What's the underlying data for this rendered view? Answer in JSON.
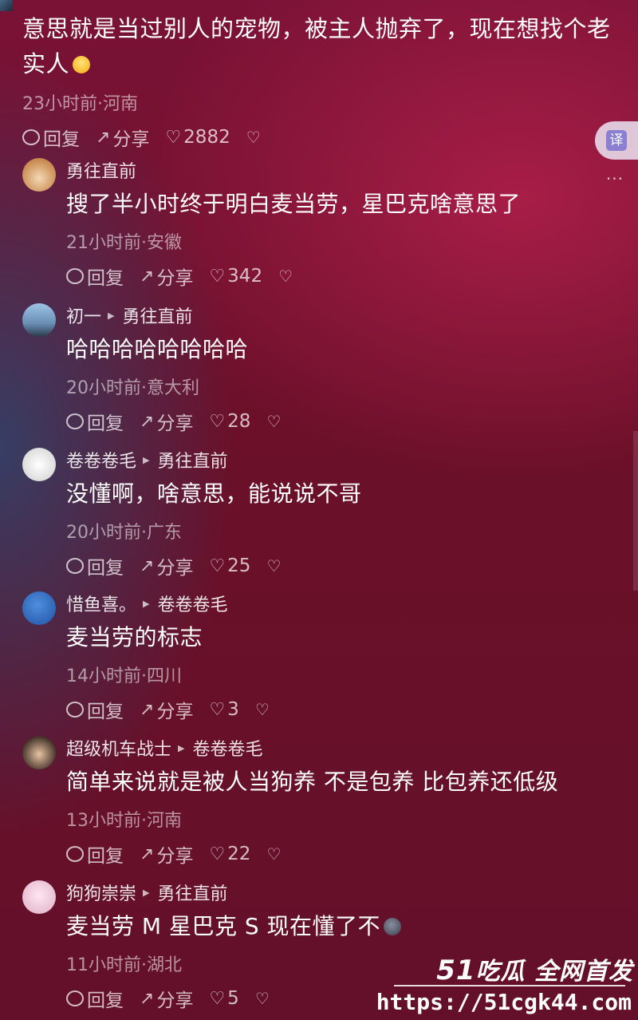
{
  "top_comment": {
    "text": "意思就是当过别人的宠物，被主人抛弃了，现在想找个老实人",
    "meta": "23小时前·河南",
    "reply": "回复",
    "share": "分享",
    "likes": "2882"
  },
  "translate_button": {
    "label": "译"
  },
  "more_button": {
    "label": "···"
  },
  "comments": [
    {
      "user": "勇往直前",
      "reply_to": "",
      "text": "搜了半小时终于明白麦当劳，星巴克啥意思了",
      "meta": "21小时前·安徽",
      "reply": "回复",
      "share": "分享",
      "likes": "342"
    },
    {
      "user": "初一",
      "reply_to": "勇往直前",
      "text": "哈哈哈哈哈哈哈哈",
      "meta": "20小时前·意大利",
      "reply": "回复",
      "share": "分享",
      "likes": "28"
    },
    {
      "user": "卷卷卷毛",
      "reply_to": "勇往直前",
      "text": "没懂啊，啥意思，能说说不哥",
      "meta": "20小时前·广东",
      "reply": "回复",
      "share": "分享",
      "likes": "25"
    },
    {
      "user": "惜鱼喜。",
      "reply_to": "卷卷卷毛",
      "text": "麦当劳的标志",
      "meta": "14小时前·四川",
      "reply": "回复",
      "share": "分享",
      "likes": "3"
    },
    {
      "user": "超级机车战士",
      "reply_to": "卷卷卷毛",
      "text": "简单来说就是被人当狗养 不是包养 比包养还低级",
      "meta": "13小时前·河南",
      "reply": "回复",
      "share": "分享",
      "likes": "22"
    },
    {
      "user": "狗狗崇崇",
      "reply_to": "勇往直前",
      "text": "麦当劳 M 星巴克 S 现在懂了不",
      "meta": "11小时前·湖北",
      "reply": "回复",
      "share": "分享",
      "likes": "5"
    }
  ],
  "watermark": {
    "number": "51",
    "brand": "吃瓜 全网首发",
    "url": "https://51cgk44.com"
  },
  "colors": {
    "bg_top": "#7a1236",
    "bg_bottom": "#64102a",
    "text_muted": "#a68391"
  }
}
